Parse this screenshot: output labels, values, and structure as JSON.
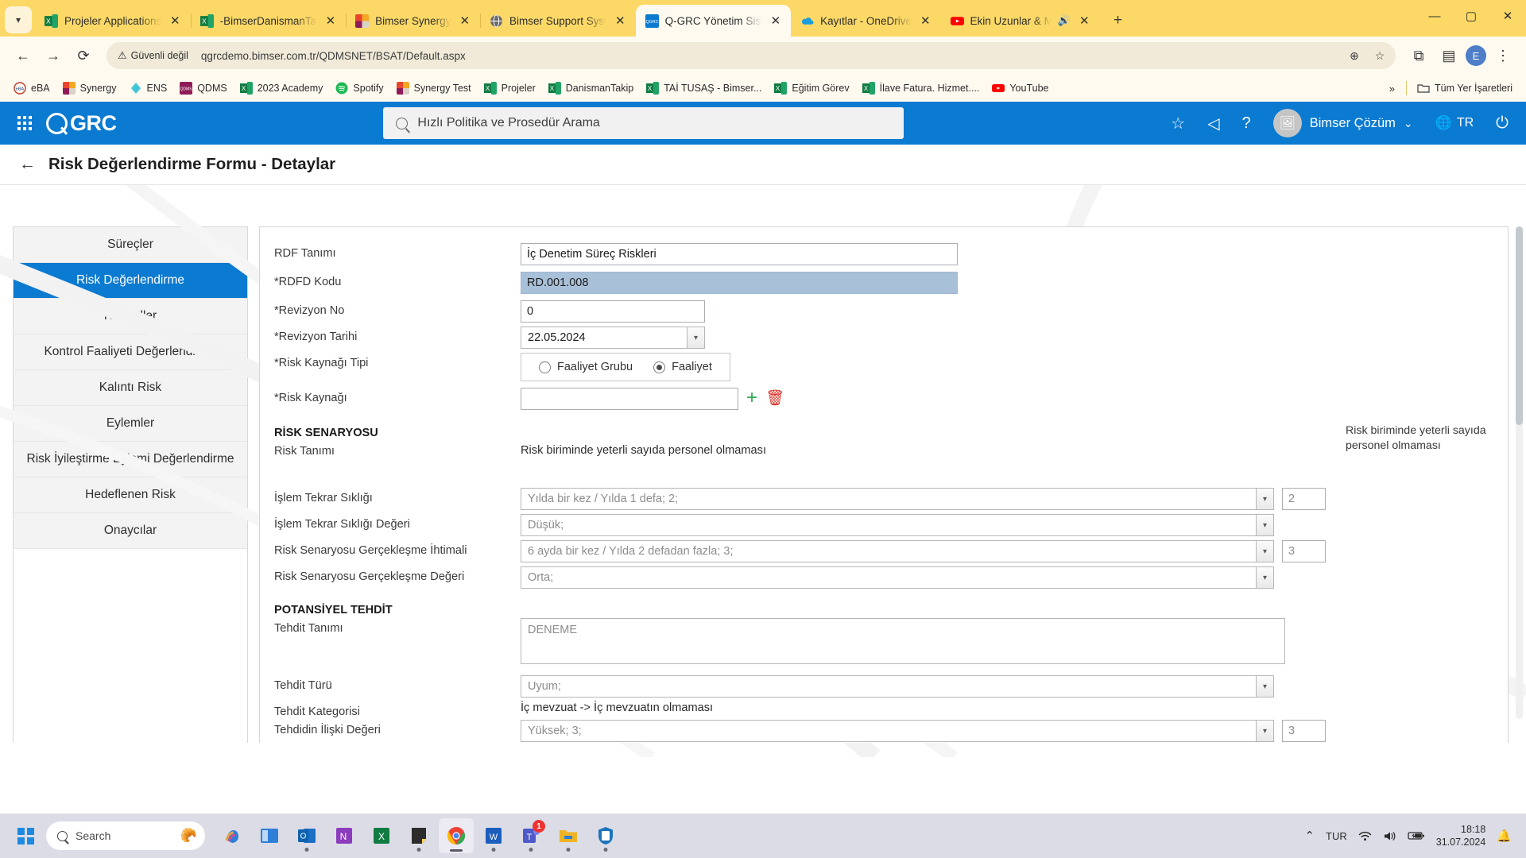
{
  "browser": {
    "tabs": [
      {
        "label": "Projeler Applications",
        "icon": "excel-icon",
        "active": false
      },
      {
        "label": "-BimserDanismanTakip",
        "icon": "excel-icon",
        "active": false
      },
      {
        "label": "Bimser Synergy",
        "icon": "synergy-icon",
        "active": false
      },
      {
        "label": "Bimser Support System",
        "icon": "globe-icon",
        "active": false
      },
      {
        "label": "Q-GRC Yönetim Sistemi",
        "icon": "qgrc-icon",
        "active": true
      },
      {
        "label": "Kayıtlar - OneDrive",
        "icon": "onedrive-icon",
        "active": false
      },
      {
        "label": "Ekin Uzunlar & M",
        "icon": "youtube-icon",
        "active": false,
        "audio": true
      }
    ],
    "close_label": "✕",
    "new_tab_label": "+",
    "window_controls": {
      "minimize": "—",
      "maximize": "▢",
      "close": "✕"
    },
    "nav": {
      "back": "←",
      "forward": "→",
      "reload": "⟳"
    },
    "security_label": "Güvenli değil",
    "security_icon": "warning-triangle-icon",
    "url": "qgrcdemo.bimser.com.tr/QDMSNET/BSAT/Default.aspx",
    "omnibox_icons": {
      "zoom": "⊕",
      "bookmark": "☆",
      "extensions": "⧉",
      "reading_list": "▤",
      "menu": "⋮"
    },
    "profile_initial": "E",
    "bookmarks": [
      {
        "label": "eBA",
        "icon": "eba-icon"
      },
      {
        "label": "Synergy",
        "icon": "synergy-icon"
      },
      {
        "label": "ENS",
        "icon": "ens-icon"
      },
      {
        "label": "QDMS",
        "icon": "qdms-icon"
      },
      {
        "label": "2023 Academy",
        "icon": "excel-icon"
      },
      {
        "label": "Spotify",
        "icon": "spotify-icon"
      },
      {
        "label": "Synergy Test",
        "icon": "synergy-icon"
      },
      {
        "label": "Projeler",
        "icon": "excel-icon"
      },
      {
        "label": "DanismanTakip",
        "icon": "excel-icon"
      },
      {
        "label": "TAİ TUSAŞ - Bimser...",
        "icon": "excel-icon"
      },
      {
        "label": "Eğitim Görev",
        "icon": "excel-icon"
      },
      {
        "label": "İlave Fatura. Hizmet....",
        "icon": "excel-icon"
      },
      {
        "label": "YouTube",
        "icon": "youtube-icon"
      }
    ],
    "bookmarks_overflow": "»",
    "all_bookmarks_label": "Tüm Yer İşaretleri",
    "all_bookmarks_icon": "folder-icon"
  },
  "app": {
    "brand": "GRC",
    "apps_grid_icon": "apps-grid-icon",
    "search_placeholder": "Hızlı Politika ve Prosedür Arama",
    "search_icon": "search-icon",
    "header_icons": [
      {
        "name": "favorites-star-icon",
        "glyph": "☆"
      },
      {
        "name": "announcement-icon",
        "glyph": "◁"
      },
      {
        "name": "help-icon",
        "glyph": "?"
      }
    ],
    "user_name": "Bimser Çözüm",
    "user_chevron": "⌄",
    "avatar_icon": "avatar-image-icon",
    "language": "TR",
    "language_icon": "translate-icon",
    "power_icon": "power-icon",
    "accent_color": "#0b7ad1",
    "page_title": "Risk Değerlendirme Formu - Detaylar",
    "back_icon": "back-arrow-icon"
  },
  "sidebar": {
    "items": [
      {
        "label": "Süreçler",
        "active": false
      },
      {
        "label": "Risk Değerlendirme",
        "active": true
      },
      {
        "label": "Kontroller",
        "active": false
      },
      {
        "label": "Kontrol Faaliyeti Değerlendirme",
        "active": false
      },
      {
        "label": "Kalıntı Risk",
        "active": false
      },
      {
        "label": "Eylemler",
        "active": false
      },
      {
        "label": "Risk İyileştirme Eylemi Değerlendirme",
        "active": false
      },
      {
        "label": "Hedeflenen Risk",
        "active": false
      },
      {
        "label": "Onaycılar",
        "active": false
      }
    ]
  },
  "form": {
    "rdf_tanimi_label": "RDF Tanımı",
    "rdf_tanimi_value": "İç Denetim Süreç Riskleri",
    "rdfd_kodu_label": "*RDFD Kodu",
    "rdfd_kodu_value": "RD.001.008",
    "revizyon_no_label": "*Revizyon No",
    "revizyon_no_value": "0",
    "revizyon_tarihi_label": "*Revizyon Tarihi",
    "revizyon_tarihi_value": "22.05.2024",
    "risk_kaynagi_tipi_label": "*Risk Kaynağı Tipi",
    "radio_faaliyet_grubu": "Faaliyet Grubu",
    "radio_faaliyet": "Faaliyet",
    "radio_selected": "Faaliyet",
    "risk_kaynagi_label": "*Risk Kaynağı",
    "risk_kaynagi_value": "",
    "add_icon": "plus-icon",
    "delete_icon": "trash-icon",
    "risk_senaryosu_heading": "RİSK SENARYOSU",
    "risk_tanimi_label": "Risk Tanımı",
    "risk_tanimi_value": "Risk biriminde yeterli sayıda personel olmaması",
    "risk_tanimi_side_note": "Risk biriminde yeterli sayıda personel olmaması",
    "islem_tekrar_sikligi_label": "İşlem Tekrar Sıklığı",
    "islem_tekrar_sikligi_value": "Yılda bir kez / Yılda 1 defa; 2;",
    "islem_tekrar_sikligi_num": "2",
    "islem_tekrar_sikligi_degeri_label": "İşlem Tekrar Sıklığı Değeri",
    "islem_tekrar_sikligi_degeri_value": "Düşük;",
    "risk_gerceklesme_ihtimali_label": "Risk Senaryosu Gerçekleşme İhtimali",
    "risk_gerceklesme_ihtimali_value": "6 ayda bir kez / Yılda 2 defadan fazla; 3;",
    "risk_gerceklesme_ihtimali_num": "3",
    "risk_gerceklesme_degeri_label": "Risk Senaryosu Gerçekleşme Değeri",
    "risk_gerceklesme_degeri_value": "Orta;",
    "potansiyel_tehdit_heading": "POTANSİYEL TEHDİT",
    "tehdit_tanimi_label": "Tehdit Tanımı",
    "tehdit_tanimi_value": "DENEME",
    "tehdit_turu_label": "Tehdit Türü",
    "tehdit_turu_value": "Uyum;",
    "tehdit_kategorisi_label": "Tehdit Kategorisi",
    "tehdit_kategorisi_value": "İç mevzuat -> İç mevzuatın olmaması",
    "tehdidin_iliski_degeri_label": "Tehdidin İlişki Değeri",
    "tehdidin_iliski_degeri_value": "Yüksek; 3;",
    "tehdidin_iliski_degeri_num": "3",
    "dropdown_icon": "chevron-down-icon"
  },
  "taskbar": {
    "start_icon": "windows-start-icon",
    "search_placeholder": "Search",
    "search_icon": "search-icon",
    "search_emoji": "🥐",
    "apps": [
      {
        "name": "copilot-icon",
        "active": false,
        "running": false
      },
      {
        "name": "task-view-icon",
        "active": false,
        "running": false
      },
      {
        "name": "outlook-icon",
        "active": false,
        "running": true
      },
      {
        "name": "onenote-icon",
        "active": false,
        "running": false
      },
      {
        "name": "excel-icon",
        "active": false,
        "running": false
      },
      {
        "name": "sticky-notes-icon",
        "active": false,
        "running": true
      },
      {
        "name": "chrome-icon",
        "active": true,
        "running": true
      },
      {
        "name": "word-icon",
        "active": false,
        "running": true
      },
      {
        "name": "teams-icon",
        "active": false,
        "running": true,
        "badge": "1"
      },
      {
        "name": "file-explorer-icon",
        "active": false,
        "running": true
      },
      {
        "name": "security-icon",
        "active": false,
        "running": true
      }
    ],
    "tray_chevron": "⌃",
    "language": "TUR",
    "wifi_icon": "wifi-icon",
    "volume_icon": "volume-icon",
    "battery_icon": "battery-charging-icon",
    "time": "18:18",
    "date": "31.07.2024",
    "notification_icon": "bell-icon"
  }
}
